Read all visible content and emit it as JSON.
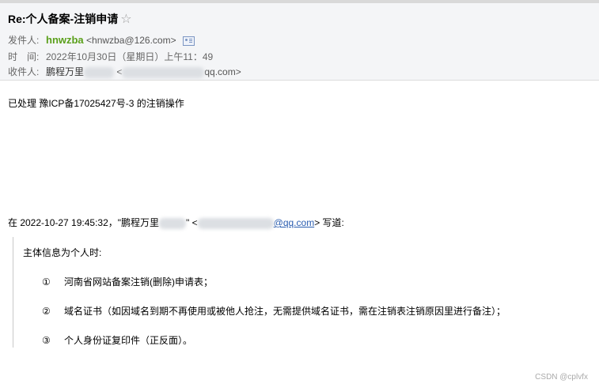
{
  "header": {
    "subject": "Re:个人备案-注销申请",
    "star": "☆",
    "from_label": "发件人:",
    "from_name": "hnwzba",
    "from_email": "<hnwzba@126.com>",
    "time_label": "时　间:",
    "time_value": "2022年10月30日（星期日）上午11：49",
    "to_label": "收件人:",
    "to_name": "鹏程万里",
    "to_email_open": "<",
    "to_email_tail": "qq.com>"
  },
  "body": {
    "message": "已处理 豫ICP备17025427号-3 的注销操作"
  },
  "quote": {
    "prefix": "在 2022-10-27 19:45:32，\"鹏程万里",
    "quote_mark": "\"",
    "email_open": "<",
    "email_tail": "@qq.com",
    "suffix": "> 写道:",
    "intro": "主体信息为个人时:",
    "items": [
      {
        "num": "①",
        "text": "河南省网站备案注销(删除)申请表；"
      },
      {
        "num": "②",
        "text": "域名证书（如因域名到期不再使用或被他人抢注，无需提供域名证书，需在注销表注销原因里进行备注）；"
      },
      {
        "num": "③",
        "text": "个人身份证复印件（正反面）。"
      }
    ]
  },
  "watermark": "CSDN @cplvfx"
}
